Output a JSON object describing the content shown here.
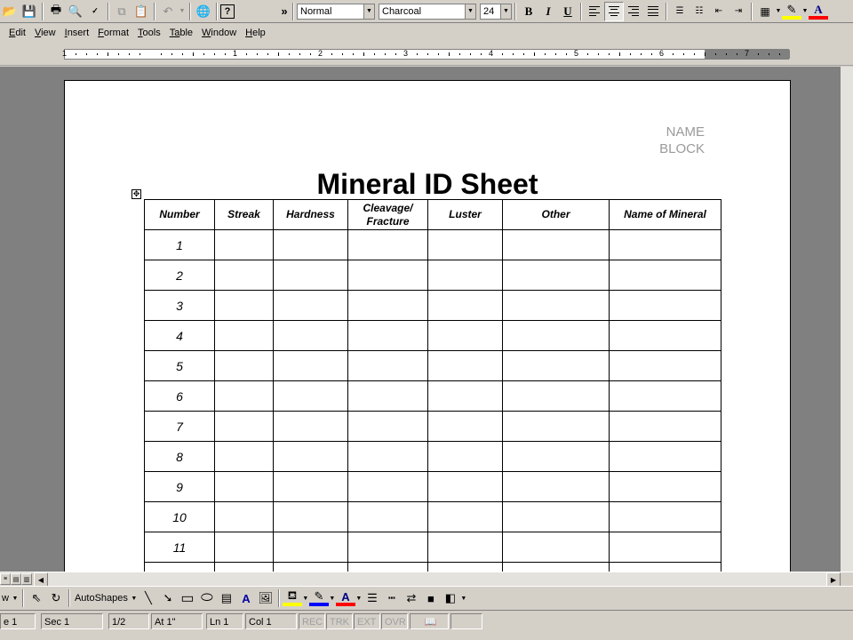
{
  "toolbar": {
    "style": "Normal",
    "font": "Charcoal",
    "size": "24",
    "more": "»",
    "bold": "B",
    "italic": "I",
    "underline": "U",
    "font_color_glyph": "A"
  },
  "menu": {
    "items": [
      {
        "key": "E",
        "rest": "dit"
      },
      {
        "key": "V",
        "rest": "iew"
      },
      {
        "key": "I",
        "rest": "nsert"
      },
      {
        "key": "F",
        "rest": "ormat"
      },
      {
        "key": "T",
        "rest": "ools"
      },
      {
        "key": "Ta",
        "rest": "ble"
      },
      {
        "key": "W",
        "rest": "indow"
      },
      {
        "key": "H",
        "rest": "elp"
      }
    ]
  },
  "ruler": {
    "numbers": [
      "1",
      "1",
      "2",
      "3",
      "4",
      "5",
      "6",
      "7"
    ]
  },
  "document": {
    "name_line1": "NAME",
    "name_line2": "BLOCK",
    "title": "Mineral ID Sheet",
    "table": {
      "headers": [
        "Number",
        "Streak",
        "Hardness",
        "Cleavage/\nFracture",
        "Luster",
        "Other",
        "Name of Mineral"
      ],
      "row_numbers": [
        "1",
        "2",
        "3",
        "4",
        "5",
        "6",
        "7",
        "8",
        "9",
        "10",
        "11",
        ""
      ]
    }
  },
  "drawing_toolbar": {
    "draw_label": "w",
    "autoshapes_label": "AutoShapes"
  },
  "statusbar": {
    "page": "e 1",
    "section": "Sec 1",
    "pages": "1/2",
    "at": "At 1\"",
    "line": "Ln 1",
    "col": "Col 1",
    "rec": "REC",
    "trk": "TRK",
    "ext": "EXT",
    "ovr": "OVR"
  }
}
